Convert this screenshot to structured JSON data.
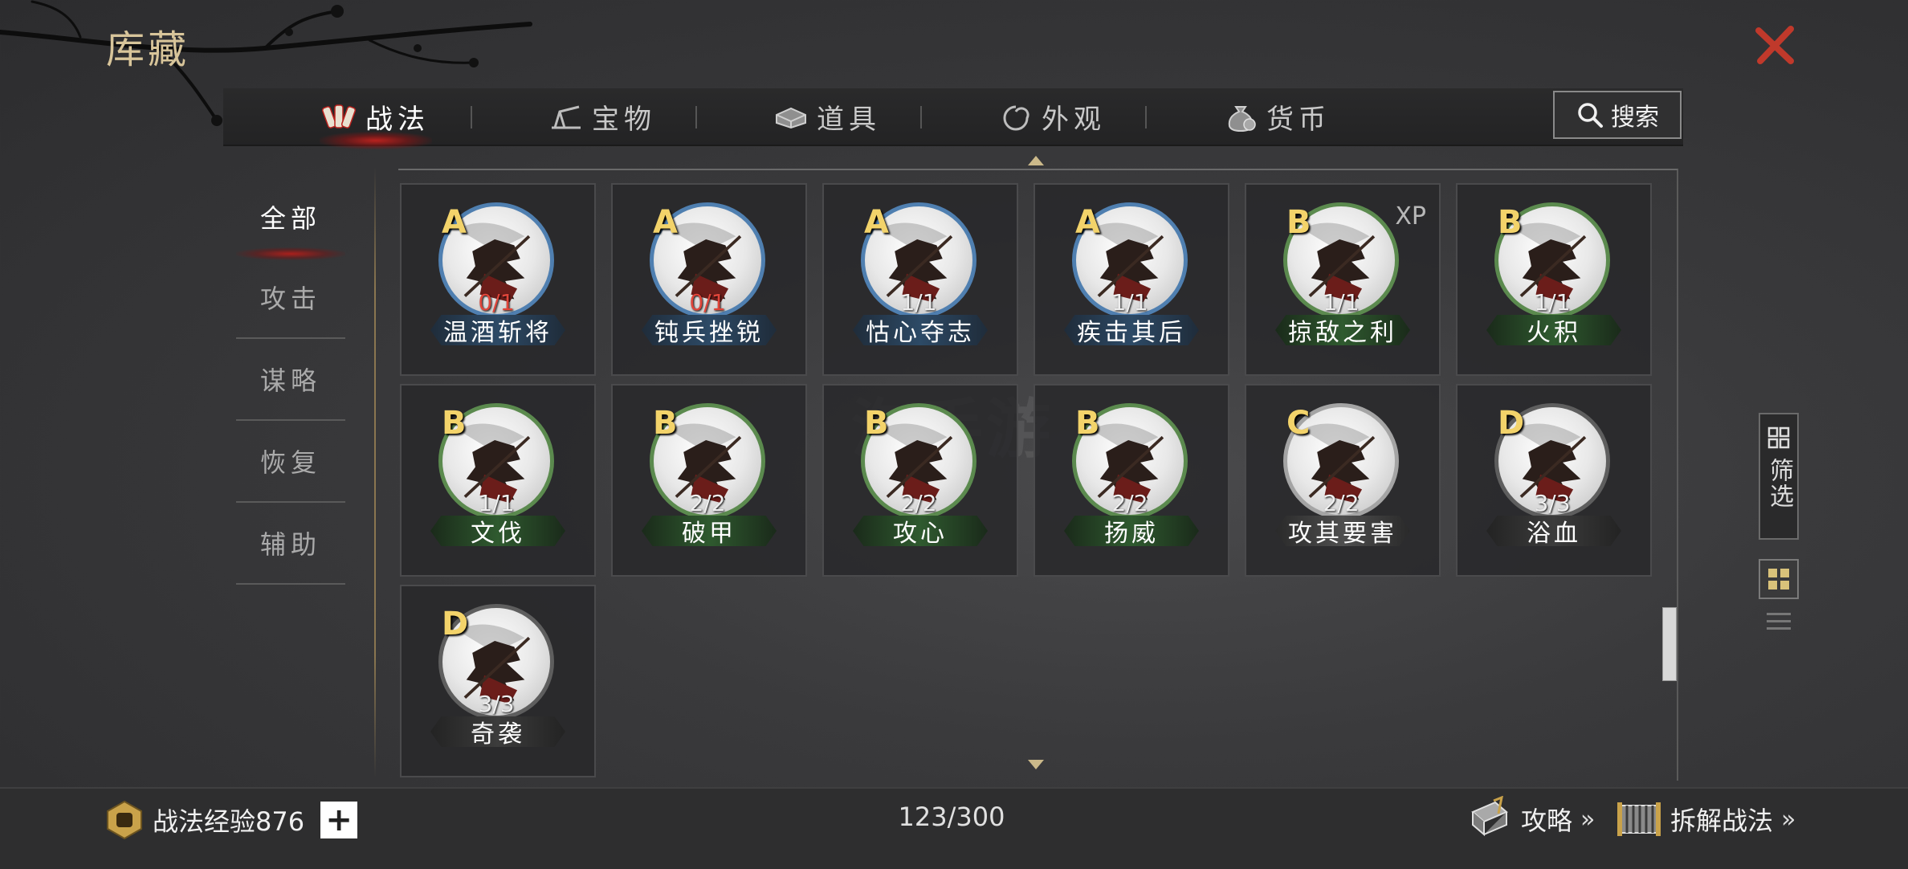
{
  "header": {
    "title": "库藏"
  },
  "tabs": [
    {
      "label": "战法",
      "icon": "scroll-bundle-icon",
      "active": true
    },
    {
      "label": "宝物",
      "icon": "treasure-icon",
      "active": false
    },
    {
      "label": "道具",
      "icon": "ingot-icon",
      "active": false
    },
    {
      "label": "外观",
      "icon": "swirl-icon",
      "active": false
    },
    {
      "label": "货币",
      "icon": "money-bag-icon",
      "active": false
    }
  ],
  "search": {
    "label": "搜索"
  },
  "side_nav": [
    {
      "label": "全部",
      "active": true
    },
    {
      "label": "攻击",
      "active": false
    },
    {
      "label": "谋略",
      "active": false
    },
    {
      "label": "恢复",
      "active": false
    },
    {
      "label": "辅助",
      "active": false
    }
  ],
  "skills": [
    {
      "grade": "A",
      "count": "0/1",
      "count_color": "#e0453a",
      "name": "温酒斩将",
      "xp": ""
    },
    {
      "grade": "A",
      "count": "0/1",
      "count_color": "#e0453a",
      "name": "钝兵挫锐",
      "xp": ""
    },
    {
      "grade": "A",
      "count": "1/1",
      "count_color": "#eeeeee",
      "name": "怙心夺志",
      "xp": ""
    },
    {
      "grade": "A",
      "count": "1/1",
      "count_color": "#eeeeee",
      "name": "疾击其后",
      "xp": ""
    },
    {
      "grade": "B",
      "count": "1/1",
      "count_color": "#eeeeee",
      "name": "掠敌之利",
      "xp": "XP"
    },
    {
      "grade": "B",
      "count": "1/1",
      "count_color": "#eeeeee",
      "name": "火积",
      "xp": ""
    },
    {
      "grade": "B",
      "count": "1/1",
      "count_color": "#eeeeee",
      "name": "文伐",
      "xp": ""
    },
    {
      "grade": "B",
      "count": "2/2",
      "count_color": "#eeeeee",
      "name": "破甲",
      "xp": ""
    },
    {
      "grade": "B",
      "count": "2/2",
      "count_color": "#eeeeee",
      "name": "攻心",
      "xp": ""
    },
    {
      "grade": "B",
      "count": "2/2",
      "count_color": "#eeeeee",
      "name": "扬威",
      "xp": ""
    },
    {
      "grade": "C",
      "count": "2/2",
      "count_color": "#eeeeee",
      "name": "攻其要害",
      "xp": ""
    },
    {
      "grade": "D",
      "count": "3/3",
      "count_color": "#eeeeee",
      "name": "浴血",
      "xp": ""
    },
    {
      "grade": "D",
      "count": "3/3",
      "count_color": "#eeeeee",
      "name": "奇袭",
      "xp": ""
    }
  ],
  "filter": {
    "label": "筛选"
  },
  "footer": {
    "exp_label": "战法经验876",
    "plus_label": "+",
    "counter": "123/300",
    "guide_label": "攻略",
    "dismantle_label": "拆解战法",
    "chevrons": "»"
  },
  "colors": {
    "accent_red": "#b8221e",
    "gold": "#d8c59a",
    "grade_A": "#4f7fb0",
    "grade_B": "#5b8a4e",
    "grade_C": "#a4a4a4",
    "grade_D": "#5e5e5e"
  }
}
